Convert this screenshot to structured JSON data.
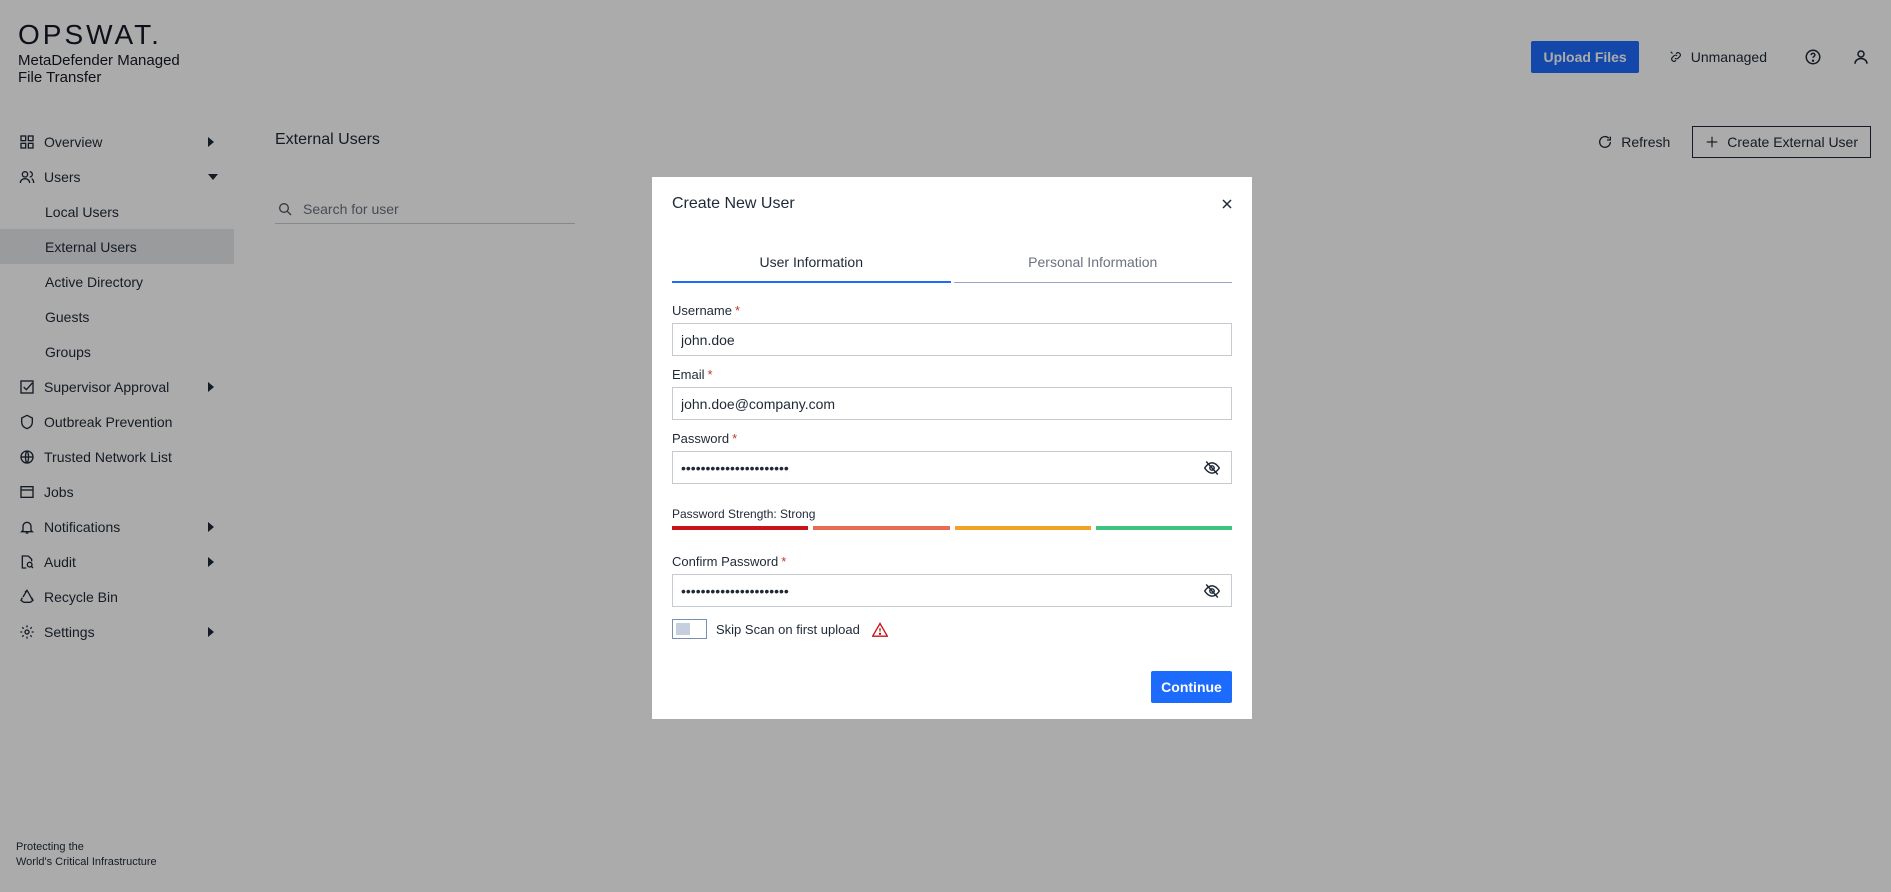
{
  "app": {
    "logo": "OPSWAT.",
    "product_name": "MetaDefender Managed File Transfer",
    "tagline_line1": "Protecting the",
    "tagline_line2": "World's Critical Infrastructure"
  },
  "topbar": {
    "upload_label": "Upload Files",
    "status_label": "Unmanaged"
  },
  "sidebar": {
    "items": [
      {
        "label": "Overview",
        "icon": "grid-icon",
        "expandable": true,
        "expanded": false
      },
      {
        "label": "Users",
        "icon": "users-icon",
        "expandable": true,
        "expanded": true
      },
      {
        "label": "Supervisor Approval",
        "icon": "checkbox-icon",
        "expandable": true,
        "expanded": false
      },
      {
        "label": "Outbreak Prevention",
        "icon": "shield-icon",
        "expandable": false
      },
      {
        "label": "Trusted Network List",
        "icon": "globe-icon",
        "expandable": false
      },
      {
        "label": "Jobs",
        "icon": "jobs-icon",
        "expandable": false
      },
      {
        "label": "Notifications",
        "icon": "bell-icon",
        "expandable": true,
        "expanded": false
      },
      {
        "label": "Audit",
        "icon": "audit-icon",
        "expandable": true,
        "expanded": false
      },
      {
        "label": "Recycle Bin",
        "icon": "recycle-icon",
        "expandable": false
      },
      {
        "label": "Settings",
        "icon": "gear-icon",
        "expandable": true,
        "expanded": false
      }
    ],
    "users_sub": [
      {
        "label": "Local Users",
        "active": false
      },
      {
        "label": "External Users",
        "active": true
      },
      {
        "label": "Active Directory",
        "active": false
      },
      {
        "label": "Guests",
        "active": false
      },
      {
        "label": "Groups",
        "active": false
      }
    ]
  },
  "main": {
    "title": "External Users",
    "search_placeholder": "Search for user",
    "refresh_label": "Refresh",
    "create_label": "Create External User"
  },
  "modal": {
    "title": "Create New User",
    "tabs": [
      {
        "label": "User Information",
        "active": true
      },
      {
        "label": "Personal Information",
        "active": false
      }
    ],
    "username_label": "Username",
    "username_value": "john.doe",
    "email_label": "Email",
    "email_value": "john.doe@company.com",
    "password_label": "Password",
    "password_value": "••••••••••••••••••••••",
    "strength_label": "Password Strength: Strong",
    "strength_colors": [
      "#c8131b",
      "#e96b52",
      "#f2a325",
      "#3dc47e"
    ],
    "confirm_label": "Confirm Password",
    "confirm_value": "••••••••••••••••••••••",
    "required_mark": "*",
    "skip_scan_label": "Skip Scan on first upload",
    "skip_scan_enabled": false,
    "continue_label": "Continue"
  },
  "colors": {
    "primary": "#1d6bfc",
    "warning": "#c8131b"
  }
}
